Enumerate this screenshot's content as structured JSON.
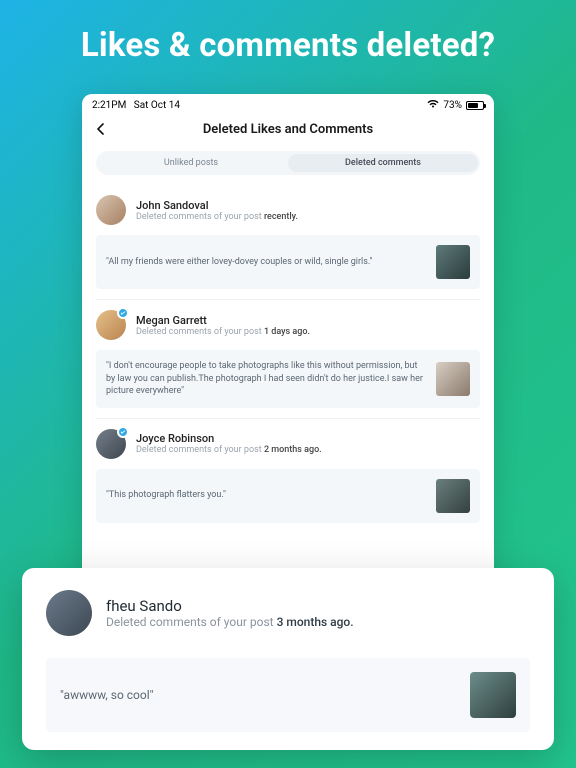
{
  "hero": {
    "title": "Likes & comments deleted?"
  },
  "status": {
    "time": "2:21PM",
    "date": "Sat Oct 14",
    "wifi": "wifi-icon",
    "battery_pct": "73%"
  },
  "nav": {
    "back": "‹",
    "title": "Deleted Likes and Comments"
  },
  "tabs": {
    "left": "Unliked posts",
    "right": "Deleted comments"
  },
  "items": [
    {
      "name": "John Sandoval",
      "prefix": "Deleted comments of your post ",
      "time": "recently.",
      "comment": "\"All my friends were either lovey-dovey couples or wild, single girls.\"",
      "badge": false
    },
    {
      "name": "Megan Garrett",
      "prefix": "Deleted comments of your post ",
      "time": "1 days ago.",
      "comment": "\"I don't encourage people to take photographs like this without permission, but by law you can publish.The photograph I had seen didn't do her justice.I saw her picture everywhere\"",
      "badge": true
    },
    {
      "name": "Joyce Robinson",
      "prefix": "Deleted comments of your post ",
      "time": "2 months ago.",
      "comment": "\"This photograph flatters you.\"",
      "badge": true
    }
  ],
  "feature": {
    "name": "fheu Sando",
    "prefix": "Deleted comments of your post ",
    "time": "3 months ago.",
    "comment": "\"awwww, so cool\""
  }
}
